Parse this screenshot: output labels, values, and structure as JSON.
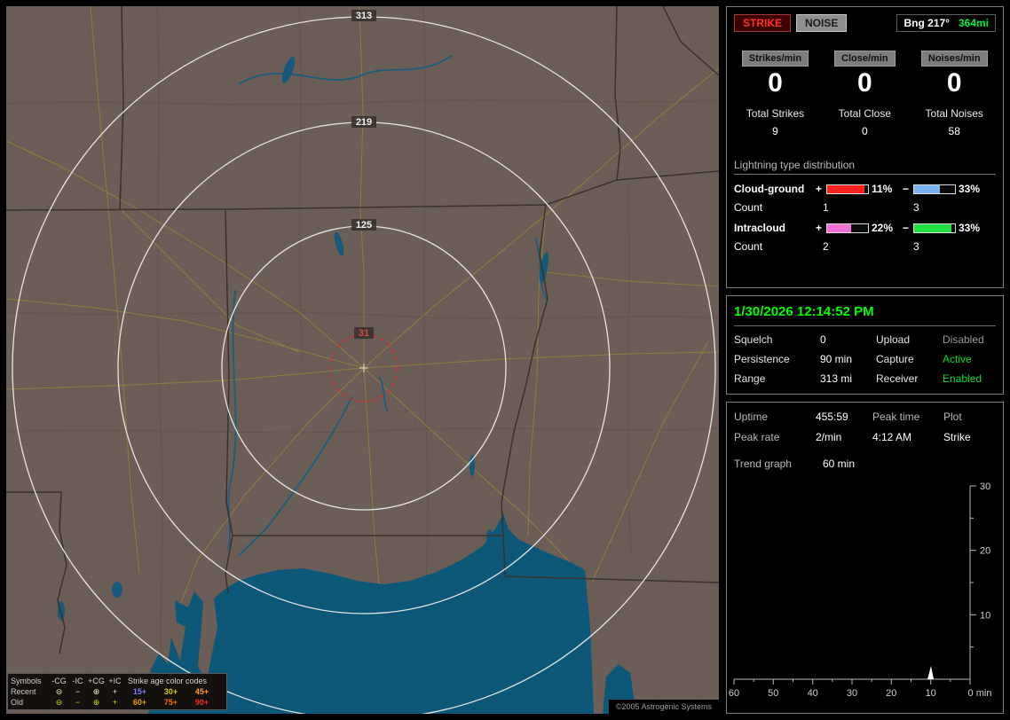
{
  "map": {
    "range_labels": {
      "outer": "313",
      "mid": "219",
      "inner": "125",
      "center": "31"
    },
    "copyright": "©2005 Astrogenic Systems",
    "legend": {
      "symbols_header": "Symbols",
      "columns": [
        "-CG",
        "-IC",
        "+CG",
        "+IC"
      ],
      "age_header": "Strike age color codes",
      "recent_label": "Recent",
      "old_label": "Old",
      "symbols": {
        "ncg": "⊖",
        "nic": "−",
        "pcg": "⊕",
        "pic": "+"
      },
      "recent_ages": [
        "15+",
        "30+",
        "45+"
      ],
      "old_ages": [
        "60+",
        "75+",
        "90+"
      ],
      "age_colors": {
        "a15": "#7b7bff",
        "a30": "#cfcf00",
        "a45": "#ff9b2e",
        "a60": "#e8a000",
        "a75": "#ff6a00",
        "a90": "#ff2a2a"
      }
    }
  },
  "panel": {
    "strike_button": "STRIKE",
    "noise_button": "NOISE",
    "bearing": {
      "label": "Bng 217°",
      "value": "364mi",
      "value_color": "#00ee44"
    },
    "rates": [
      {
        "label": "Strikes/min",
        "value": "0"
      },
      {
        "label": "Close/min",
        "value": "0"
      },
      {
        "label": "Noises/min",
        "value": "0"
      }
    ],
    "totals": [
      {
        "label": "Total Strikes",
        "value": "9"
      },
      {
        "label": "Total Close",
        "value": "0"
      },
      {
        "label": "Total Noises",
        "value": "58"
      }
    ],
    "distribution": {
      "title": "Lightning type distribution",
      "count_label": "Count",
      "cloud_ground": {
        "label": "Cloud-ground",
        "plus_sign": "+",
        "plus_pct": "11%",
        "plus_count": "1",
        "plus_color": "#ff2020",
        "minus_sign": "−",
        "minus_pct": "33%",
        "minus_count": "3",
        "minus_color": "#7ab2f0"
      },
      "intracloud": {
        "label": "Intracloud",
        "plus_sign": "+",
        "plus_pct": "22%",
        "plus_count": "2",
        "plus_color": "#f070d8",
        "minus_sign": "−",
        "minus_pct": "33%",
        "minus_count": "3",
        "minus_color": "#22e044"
      }
    },
    "status": {
      "datetime": "1/30/2026 12:14:52 PM",
      "squelch_label": "Squelch",
      "squelch_value": "0",
      "persistence_label": "Persistence",
      "persistence_value": "90 min",
      "range_label": "Range",
      "range_value": "313 mi",
      "upload_label": "Upload",
      "upload_value": "Disabled",
      "capture_label": "Capture",
      "capture_value": "Active",
      "receiver_label": "Receiver",
      "receiver_value": "Enabled"
    },
    "stats": {
      "uptime_label": "Uptime",
      "uptime_value": "455:59",
      "peak_time_label": "Peak time",
      "peak_time_value": "4:12 AM",
      "plot_label": "Plot",
      "plot_value": "Strike",
      "peak_rate_label": "Peak rate",
      "peak_rate_value": "2/min",
      "trend_label": "Trend graph",
      "trend_value": "60 min"
    },
    "trend_chart": {
      "type": "line",
      "title": "Trend graph 60 min",
      "x_ticks": [
        "60",
        "50",
        "40",
        "30",
        "20",
        "10"
      ],
      "x_end_label": "0 min",
      "y_ticks": [
        "30",
        "20",
        "10"
      ],
      "x_range": [
        60,
        0
      ],
      "y_range": [
        0,
        30
      ],
      "series": [
        {
          "name": "Strike rate",
          "points": [
            {
              "x": 10,
              "y": 2
            }
          ]
        }
      ]
    }
  }
}
